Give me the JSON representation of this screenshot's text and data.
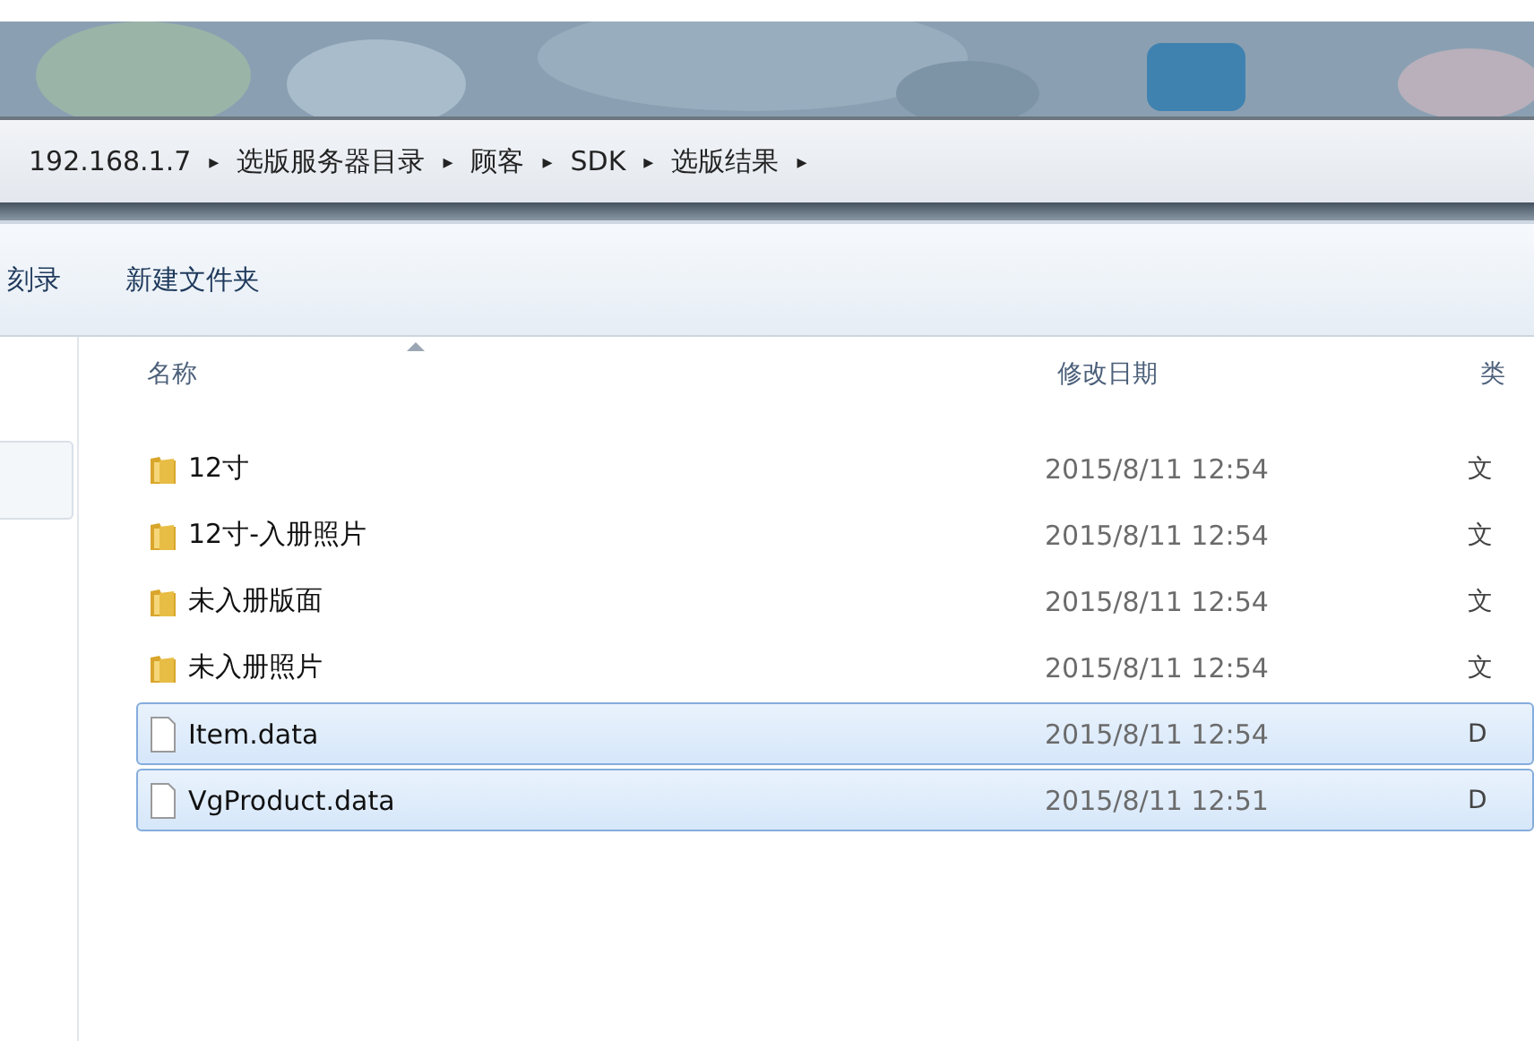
{
  "breadcrumb": {
    "segments": [
      "192.168.1.7",
      "选版服务器目录",
      "顾客",
      "SDK",
      "选版结果"
    ],
    "separator": "▸"
  },
  "toolbar": {
    "buttons": [
      "刻录",
      "新建文件夹"
    ]
  },
  "table": {
    "columns": [
      "名称",
      "修改日期",
      "类"
    ],
    "rows": [
      {
        "kind": "folder",
        "name": "12寸",
        "date": "2015/8/11 12:54",
        "column_3": "文",
        "selected": false
      },
      {
        "kind": "folder",
        "name": "12寸-入册照片",
        "date": "2015/8/11 12:54",
        "column_3": "文",
        "selected": false
      },
      {
        "kind": "folder",
        "name": "未入册版面",
        "date": "2015/8/11 12:54",
        "column_3": "文",
        "selected": false
      },
      {
        "kind": "folder",
        "name": "未入册照片",
        "date": "2015/8/11 12:54",
        "column_3": "文",
        "selected": false
      },
      {
        "kind": "file",
        "name": "Item.data",
        "date": "2015/8/11 12:54",
        "column_3": "D",
        "selected": true
      },
      {
        "kind": "file",
        "name": "VgProduct.data",
        "date": "2015/8/11 12:51",
        "column_3": "D",
        "selected": true
      }
    ]
  }
}
